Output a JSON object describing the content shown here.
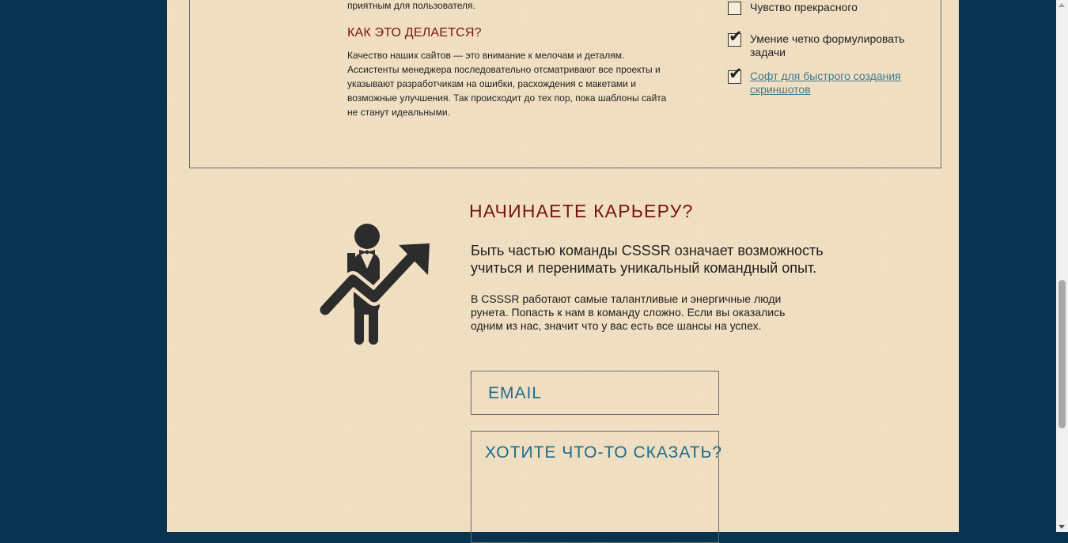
{
  "quality_section": {
    "fragment_text": "приятным для пользователя.",
    "how_title": "КАК ЭТО ДЕЛАЕТСЯ?",
    "how_text": "Качество наших сайтов — это внимание к мелочам и деталям. Ассистенты менеджера последовательно отсматривают все проекты и указывают разработчикам на ошибки, расхождения с макетами и возможные улучшения. Так происходит до тех пор, пока шаблоны сайта не станут идеальными.",
    "checklist": [
      {
        "label": "Чувство прекрасного",
        "checked": false,
        "is_link": false
      },
      {
        "label": "Умение четко формулировать задачи",
        "checked": true,
        "is_link": false
      },
      {
        "label": "Софт для быстрого создания скриншотов",
        "checked": true,
        "is_link": true
      }
    ]
  },
  "career_section": {
    "title": "НАЧИНАЕТЕ КАРЬЕРУ?",
    "icon": "career-growth-icon",
    "lead": "Быть частью команды CSSSR означает возможность учиться и перенимать уникальный командный опыт.",
    "description": "В CSSSR работают самые талантливые и энергичные люди рунета. Попасть к нам в команду сложно. Если вы оказались одним из нас, значит что у вас есть все шансы на успех.",
    "email_placeholder": "EMAIL",
    "message_placeholder": "ХОТИТЕ ЧТО-ТО СКАЗАТЬ?"
  },
  "colors": {
    "page_background": "#05324f",
    "paper": "#f0dfc2",
    "heading_red": "#7a1414",
    "input_text_blue": "#1d6c8e",
    "link_blue": "#3e7a93"
  }
}
